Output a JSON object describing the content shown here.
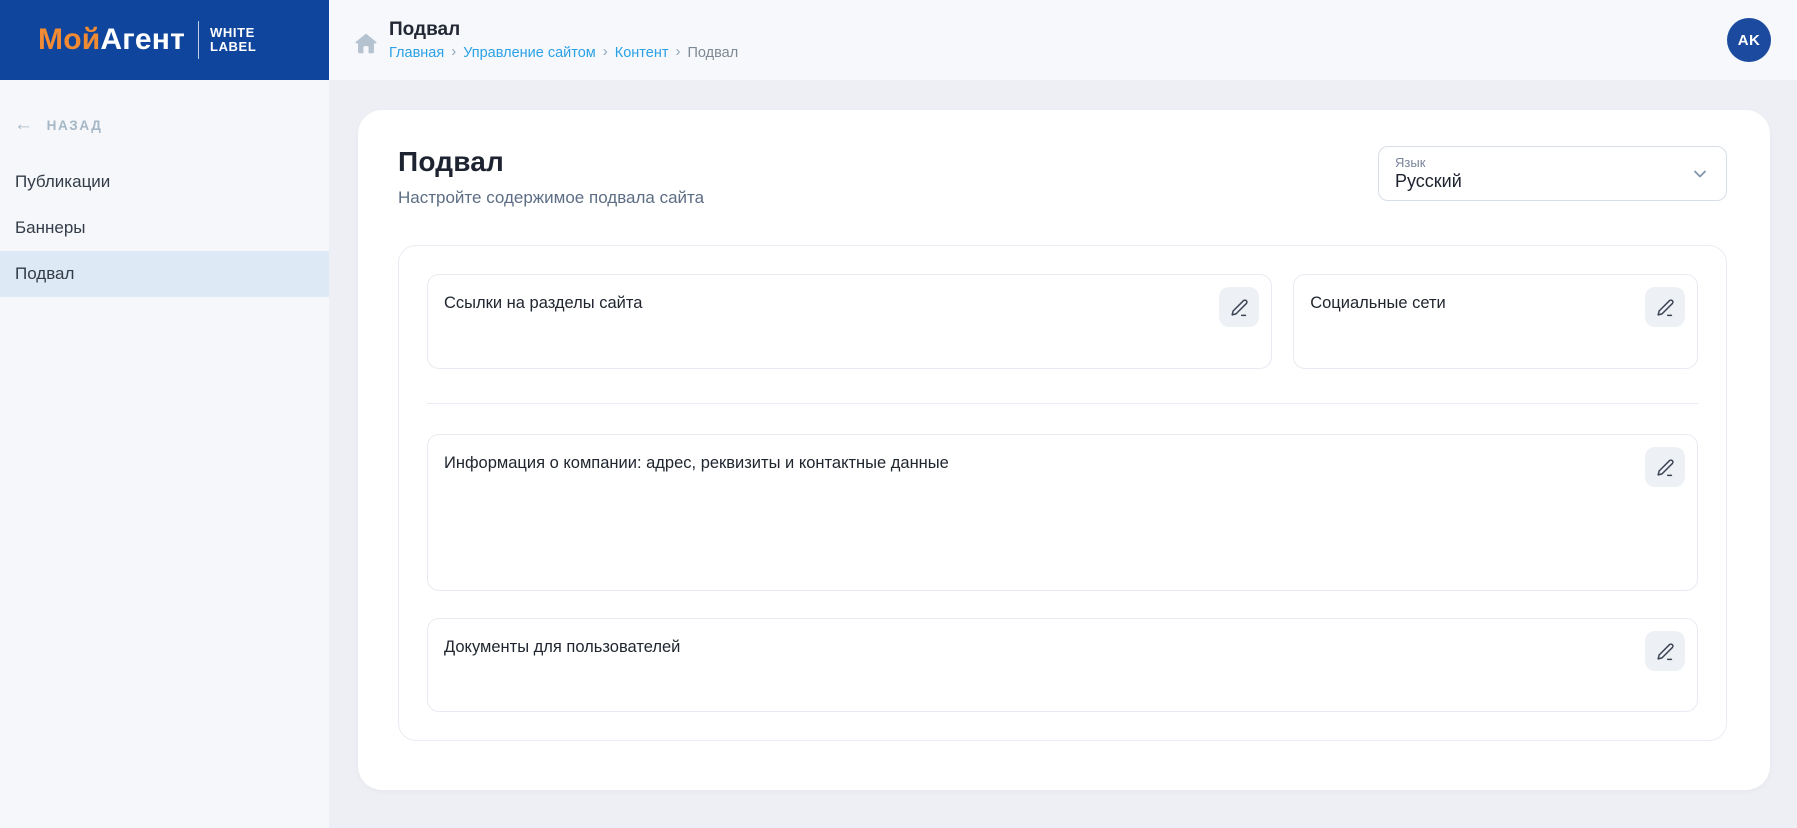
{
  "brand": {
    "logo_primary": "Мой",
    "logo_secondary": "Агент",
    "badge_line1": "WHITE",
    "badge_line2": "LABEL"
  },
  "sidebar": {
    "back_arrow": "←",
    "back_label": "НАЗАД",
    "items": [
      {
        "label": "Публикации"
      },
      {
        "label": "Баннеры"
      },
      {
        "label": "Подвал"
      }
    ]
  },
  "header": {
    "page_title": "Подвал",
    "breadcrumb": {
      "separator": "›",
      "links": [
        {
          "label": "Главная"
        },
        {
          "label": "Управление сайтом"
        },
        {
          "label": "Контент"
        }
      ],
      "current": "Подвал"
    },
    "avatar_initials": "AK"
  },
  "main": {
    "title": "Подвал",
    "subtitle": "Настройте содержимое подвала сайта",
    "language_select": {
      "label": "Язык",
      "value": "Русский"
    },
    "cards": [
      {
        "title": "Ссылки на разделы сайта"
      },
      {
        "title": "Социальные сети"
      },
      {
        "title": "Информация о компании: адрес, реквизиты и контактные данные"
      },
      {
        "title": "Документы для пользователей"
      }
    ]
  },
  "colors": {
    "brand_blue": "#0f459c",
    "brand_orange": "#f08a33",
    "link_blue": "#2ba1e6",
    "active_item_bg": "#dde9f5",
    "sidebar_bg": "#f5f7fa",
    "topbar_bg": "#f6f8fc",
    "page_bg": "#edeff4"
  }
}
